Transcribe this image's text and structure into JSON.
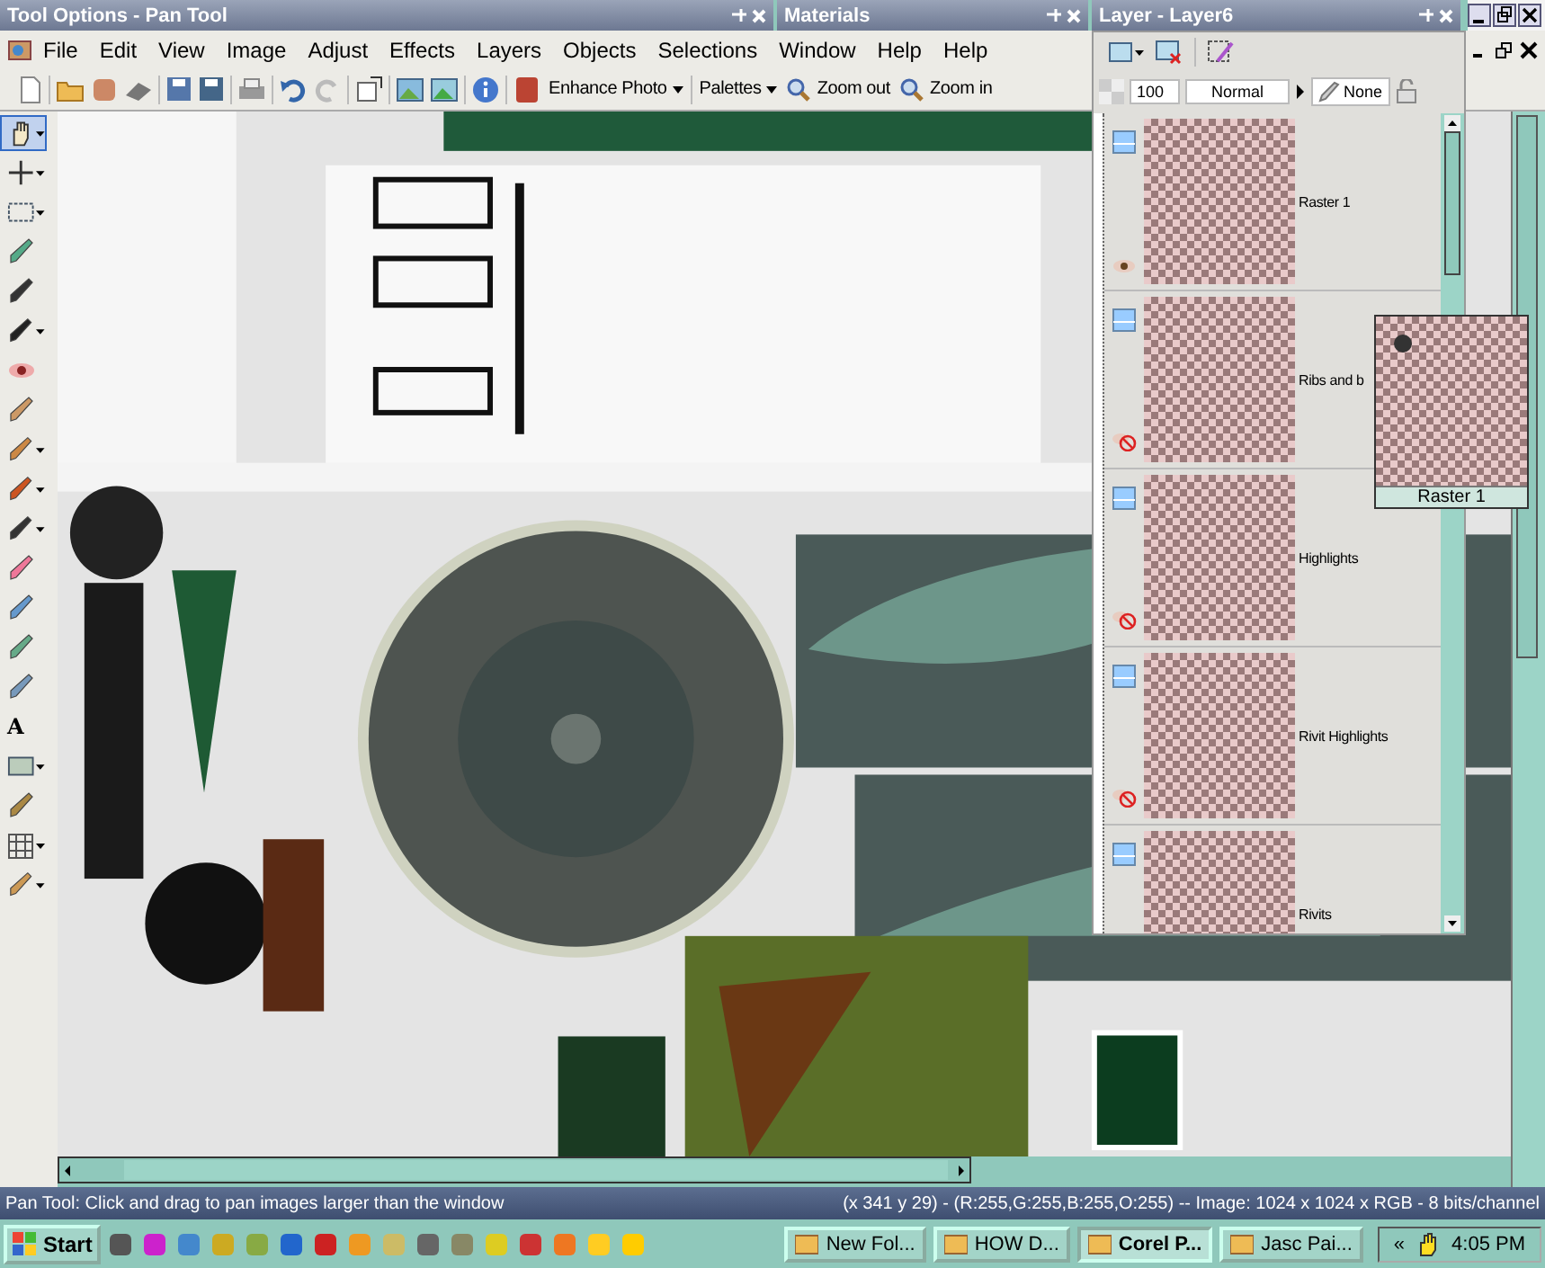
{
  "palettes": [
    {
      "kind": "tool_options",
      "title": "Tool Options - Pan Tool"
    },
    {
      "kind": "materials",
      "title": "Materials"
    },
    {
      "kind": "layers",
      "title": "Layer - Layer6"
    }
  ],
  "menu": [
    "File",
    "Edit",
    "View",
    "Image",
    "Adjust",
    "Effects",
    "Layers",
    "Objects",
    "Selections",
    "Window",
    "Help",
    "Help"
  ],
  "toolbar": {
    "enhance": "Enhance Photo",
    "palettes": "Palettes",
    "zoom_out": "Zoom out",
    "zoom_in": "Zoom in"
  },
  "layer_options": {
    "opacity": "100",
    "blend_mode": "Normal",
    "mask": "None"
  },
  "tools": [
    {
      "kind": "hand",
      "selected": true,
      "dropdown": true
    },
    {
      "kind": "move",
      "selected": false,
      "dropdown": true
    },
    {
      "kind": "selection",
      "selected": false,
      "dropdown": true
    },
    {
      "kind": "dropper",
      "selected": false,
      "dropdown": false
    },
    {
      "kind": "crop",
      "selected": false,
      "dropdown": false
    },
    {
      "kind": "deform",
      "selected": false,
      "dropdown": true
    },
    {
      "kind": "eye",
      "selected": false,
      "dropdown": false
    },
    {
      "kind": "clone",
      "selected": false,
      "dropdown": false
    },
    {
      "kind": "brush",
      "selected": false,
      "dropdown": true
    },
    {
      "kind": "brush2",
      "selected": false,
      "dropdown": true
    },
    {
      "kind": "pen",
      "selected": false,
      "dropdown": true
    },
    {
      "kind": "eraser",
      "selected": false,
      "dropdown": false
    },
    {
      "kind": "retouch",
      "selected": false,
      "dropdown": false
    },
    {
      "kind": "bucket",
      "selected": false,
      "dropdown": false
    },
    {
      "kind": "tube",
      "selected": false,
      "dropdown": false
    },
    {
      "kind": "text",
      "label": "A",
      "selected": false,
      "dropdown": false
    },
    {
      "kind": "rect",
      "selected": false,
      "dropdown": true
    },
    {
      "kind": "pencil",
      "selected": false,
      "dropdown": false
    },
    {
      "kind": "grid",
      "selected": false,
      "dropdown": true
    },
    {
      "kind": "flower",
      "selected": false,
      "dropdown": true
    }
  ],
  "layers": [
    {
      "name": "Raster 1",
      "visible": true
    },
    {
      "name": "Ribs and b",
      "visible": false
    },
    {
      "name": "Highlights",
      "visible": false
    },
    {
      "name": "Rivit Highlights",
      "visible": false
    },
    {
      "name": "Rivits"
    }
  ],
  "tooltip": {
    "label": "Raster 1"
  },
  "status_bar": {
    "hint": "Pan Tool: Click and drag to pan images larger than the window",
    "info": "(x 341 y 29) - (R:255,G:255,B:255,O:255) -- Image:  1024 x 1024 x RGB - 8 bits/channel"
  },
  "taskbar": {
    "start": "Start",
    "tasks": [
      {
        "label": "New Fol...",
        "selected": false
      },
      {
        "label": "HOW D...",
        "selected": false
      },
      {
        "label": "Corel P...",
        "selected": true
      },
      {
        "label": "Jasc Pai...",
        "selected": false
      }
    ],
    "tray_toggle": "«",
    "clock": "4:05 PM"
  }
}
